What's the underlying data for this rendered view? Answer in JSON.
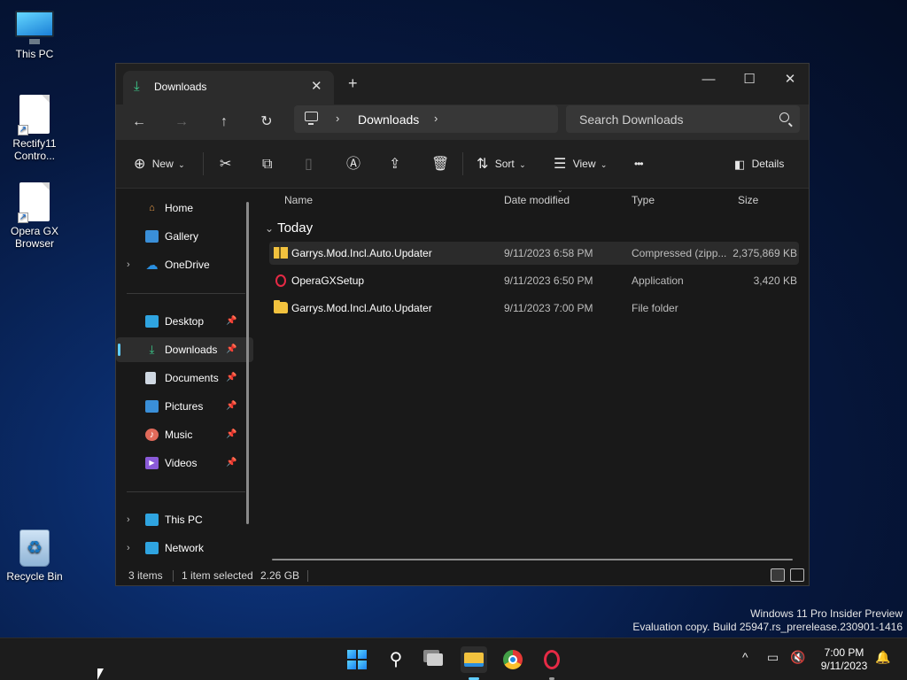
{
  "desktop": {
    "icons": [
      {
        "label_line1": "This PC",
        "label_line2": ""
      },
      {
        "label_line1": "Rectify11",
        "label_line2": "Contro..."
      },
      {
        "label_line1": "Opera GX",
        "label_line2": "Browser"
      },
      {
        "label_line1": "Recycle Bin",
        "label_line2": ""
      }
    ]
  },
  "window": {
    "tab": {
      "label": "Downloads",
      "close": "✕",
      "new_tab": "+"
    },
    "controls": {
      "minimize": "—",
      "maximize": "☐",
      "close": "✕"
    },
    "nav": {
      "back": "←",
      "forward": "→",
      "up": "↑",
      "refresh": "↻"
    },
    "address": {
      "crumb": "Downloads",
      "sep": "›"
    },
    "search": {
      "placeholder": "Search Downloads"
    },
    "toolbar": {
      "new": "New",
      "sort": "Sort",
      "view": "View",
      "more": "•••",
      "details": "Details"
    },
    "navpane": {
      "home": "Home",
      "gallery": "Gallery",
      "onedrive": "OneDrive",
      "desktop": "Desktop",
      "downloads": "Downloads",
      "documents": "Documents",
      "pictures": "Pictures",
      "music": "Music",
      "videos": "Videos",
      "thispc": "This PC",
      "network": "Network"
    },
    "columns": {
      "name": "Name",
      "date": "Date modified",
      "type": "Type",
      "size": "Size"
    },
    "group": "Today",
    "files": [
      {
        "name": "Garrys.Mod.Incl.Auto.Updater",
        "date": "9/11/2023 6:58 PM",
        "type": "Compressed (zipp...",
        "size": "2,375,869 KB",
        "icon": "zip-folder-icon",
        "selected": true
      },
      {
        "name": "OperaGXSetup",
        "date": "9/11/2023 6:50 PM",
        "type": "Application",
        "size": "3,420 KB",
        "icon": "opera-icon",
        "selected": false
      },
      {
        "name": "Garrys.Mod.Incl.Auto.Updater",
        "date": "9/11/2023 7:00 PM",
        "type": "File folder",
        "size": "",
        "icon": "folder-icon",
        "selected": false
      }
    ],
    "status": {
      "items": "3 items",
      "selection": "1 item selected",
      "selection_size": "2.26 GB"
    }
  },
  "watermark": {
    "line1": "Windows 11 Pro Insider Preview",
    "line2": "Evaluation copy. Build 25947.rs_prerelease.230901-1416"
  },
  "taskbar": {
    "time": "7:00 PM",
    "date": "9/11/2023",
    "tray_chevron": "^"
  },
  "colors": {
    "accent": "#60cdff",
    "downloads_green": "#3ccf8e",
    "folder": "#f2c23e",
    "opera": "#e52a45"
  }
}
